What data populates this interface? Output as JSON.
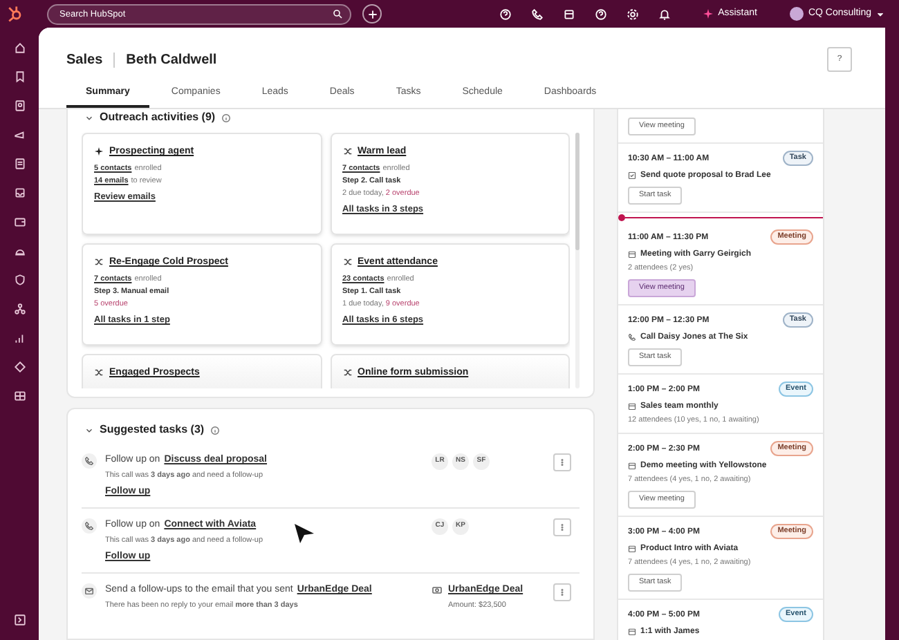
{
  "topbar": {
    "search": {
      "placeholder": "Search HubSpot"
    },
    "assistant": "Assistant",
    "account": "CQ Consulting"
  },
  "header": {
    "section": "Sales",
    "name": "Beth Caldwell",
    "help": "?"
  },
  "tabs": [
    {
      "label": "Summary",
      "selected": true
    },
    {
      "label": "Companies",
      "selected": false
    },
    {
      "label": "Leads",
      "selected": false
    },
    {
      "label": "Deals",
      "selected": false
    },
    {
      "label": "Tasks",
      "selected": false
    },
    {
      "label": "Schedule",
      "selected": false
    },
    {
      "label": "Dashboards",
      "selected": false
    }
  ],
  "outreach": {
    "title": "Outreach activities (9)",
    "cards": [
      {
        "kind": "agent",
        "title": "Prospecting agent",
        "lines": [
          {
            "kind": "count",
            "link": "5 contacts",
            "text": "enrolled"
          },
          {
            "kind": "count",
            "link": "14 emails",
            "text": "to review"
          }
        ],
        "action": "Review emails"
      },
      {
        "kind": "sequence",
        "title": "Warm lead",
        "lines": [
          {
            "kind": "count",
            "link": "7 contacts",
            "text": "enrolled"
          },
          {
            "kind": "step",
            "text": "Step 2. Call task"
          },
          {
            "kind": "due",
            "text": "2 due today, ",
            "overdue": "2 overdue"
          }
        ],
        "action": "All tasks in 3 steps"
      },
      {
        "kind": "sequence",
        "title": "Re-Engage Cold Prospect",
        "lines": [
          {
            "kind": "count",
            "link": "7 contacts",
            "text": "enrolled"
          },
          {
            "kind": "step",
            "text": "Step 3. Manual email"
          },
          {
            "kind": "due",
            "overdue": "5 overdue"
          }
        ],
        "action": "All tasks in 1 step"
      },
      {
        "kind": "sequence",
        "title": "Event attendance",
        "lines": [
          {
            "kind": "count",
            "link": "23 contacts",
            "text": "enrolled"
          },
          {
            "kind": "step",
            "text": "Step 1. Call task"
          },
          {
            "kind": "due",
            "text": "1 due today, ",
            "overdue": "9 overdue"
          }
        ],
        "action": "All tasks in 6 steps"
      },
      {
        "kind": "sequence",
        "title": "Engaged Prospects"
      },
      {
        "kind": "sequence",
        "title": "Online form submission"
      }
    ]
  },
  "suggested": {
    "title": "Suggested tasks (3)",
    "items": [
      {
        "kind": "call",
        "prefix": "Follow up on",
        "link": "Discuss deal proposal",
        "detail": "This call was **3 days ago** and need a follow-up",
        "action": "Follow up",
        "people": [
          "LR",
          "NS",
          "SF"
        ]
      },
      {
        "kind": "call",
        "prefix": "Follow up on",
        "link": "Connect with Aviata",
        "detail": "This call was **3 days ago** and need a follow-up",
        "action": "Follow up",
        "people": [
          "CJ",
          "KP"
        ]
      },
      {
        "kind": "email",
        "prefix": "Send a follow-ups to the email that you sent",
        "link": "UrbanEdge Deal",
        "detail": "There has been no reply to your email **more than 3 days**",
        "deal": {
          "name": "UrbanEdge Deal",
          "amount": "Amount: $23,500"
        }
      }
    ]
  },
  "agenda": [
    {
      "button": {
        "label": "View meeting",
        "hovered": false
      }
    },
    {
      "kind": "task",
      "time": "10:30 AM – 11:00 AM",
      "badge": {
        "kind": "task",
        "label": "Task"
      },
      "title": "Send quote proposal to Brad Lee",
      "button": {
        "label": "Start task",
        "hovered": false
      }
    },
    {
      "kind": "meeting",
      "now_line": true,
      "time": "11:00 AM – 11:30 PM",
      "badge": {
        "kind": "meeting",
        "label": "Meeting"
      },
      "title": "Meeting with Garry Geirgich",
      "attendees": "2 attendees (2 yes)",
      "button": {
        "label": "View meeting",
        "hovered": true
      }
    },
    {
      "kind": "call",
      "time": "12:00 PM – 12:30 PM",
      "badge": {
        "kind": "task",
        "label": "Task"
      },
      "title": "Call Daisy Jones at The Six",
      "button": {
        "label": "Start task",
        "hovered": false
      }
    },
    {
      "kind": "meeting",
      "time": "1:00 PM – 2:00 PM",
      "badge": {
        "kind": "event",
        "label": "Event"
      },
      "title": "Sales team monthly",
      "attendees": "12 attendees (10 yes, 1 no, 1 awaiting)"
    },
    {
      "kind": "meeting",
      "time": "2:00 PM – 2:30 PM",
      "badge": {
        "kind": "meeting",
        "label": "Meeting"
      },
      "title": "Demo meeting with Yellowstone",
      "attendees": "7 attendees (4 yes, 1 no, 2 awaiting)",
      "button": {
        "label": "View meeting",
        "hovered": false
      }
    },
    {
      "kind": "meeting",
      "time": "3:00 PM – 4:00 PM",
      "badge": {
        "kind": "meeting",
        "label": "Meeting"
      },
      "title": "Product Intro with Aviata",
      "attendees": "7 attendees (4 yes, 1 no, 2 awaiting)",
      "button": {
        "label": "Start task",
        "hovered": false
      }
    },
    {
      "kind": "meeting",
      "time": "4:00 PM – 5:00 PM",
      "badge": {
        "kind": "event",
        "label": "Event"
      },
      "title": "1:1 with James"
    }
  ]
}
